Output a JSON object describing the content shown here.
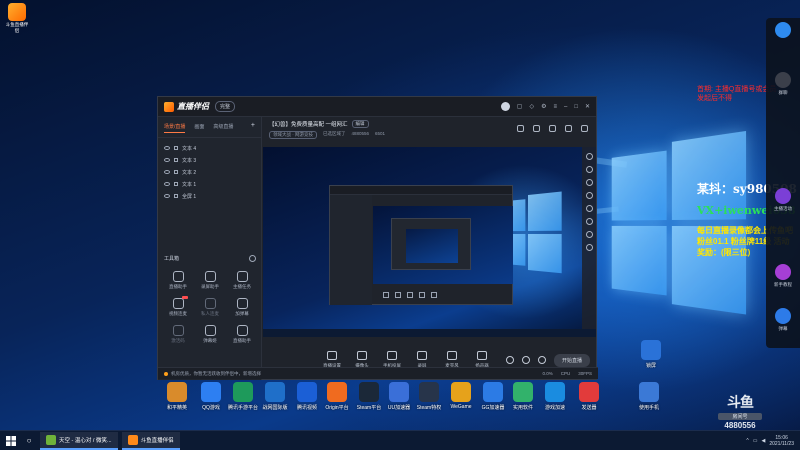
{
  "desktop": {
    "top_left_app": "斗鱼直播伴侣",
    "icons_row": [
      {
        "label": "和平精英",
        "color": "#d98b2b"
      },
      {
        "label": "QQ游戏",
        "color": "#2d7ff2"
      },
      {
        "label": "腾讯手游平台",
        "color": "#1e9a5b"
      },
      {
        "label": "战网国际版",
        "color": "#1f6fc9"
      },
      {
        "label": "腾讯视频",
        "color": "#1b5fd6"
      },
      {
        "label": "Origin平台",
        "color": "#f06b1f"
      },
      {
        "label": "Steam平台",
        "color": "#1b2838"
      },
      {
        "label": "UU加速器",
        "color": "#3a6fd8"
      },
      {
        "label": "Steam特权",
        "color": "#27344a"
      },
      {
        "label": "WeGame",
        "color": "#e6a21b"
      },
      {
        "label": "GG加速器",
        "color": "#2c7be5"
      },
      {
        "label": "实用软件",
        "color": "#32b26b"
      },
      {
        "label": "游戏加速",
        "color": "#1a8ce0"
      },
      {
        "label": "发送器",
        "color": "#e23b3b"
      },
      {
        "label": "使用手机",
        "color": "#3b79d6"
      }
    ],
    "lock_icon_label": "锁屏"
  },
  "taskbar": {
    "items": [
      {
        "label": "天空 - 温心对 / 微笑... ",
        "color": "#6fb23a"
      },
      {
        "label": "斗鱼直播伴侣",
        "color": "#ff8a1a"
      }
    ],
    "time": "15:06",
    "date": "2021/11/23"
  },
  "app": {
    "title": "直播伴侣",
    "version_badge": "完整",
    "left_tabs": [
      "场景/直播",
      "画面",
      "高级直播"
    ],
    "sources": [
      "文本 4",
      "文本 3",
      "文本 2",
      "文本 1",
      "全屏 1"
    ],
    "toolbox_title": "工具箱",
    "tools": [
      {
        "label": "直播助手",
        "dim": false,
        "new": false
      },
      {
        "label": "录屏助手",
        "dim": false,
        "new": false
      },
      {
        "label": "主播任务",
        "dim": false,
        "new": false
      },
      {
        "label": "视频连麦",
        "dim": false,
        "new": true
      },
      {
        "label": "私人连麦",
        "dim": true,
        "new": false
      },
      {
        "label": "加弹幕",
        "dim": false,
        "new": false
      },
      {
        "label": "激活码",
        "dim": true,
        "new": false
      },
      {
        "label": "弹幕姬",
        "dim": false,
        "new": false
      },
      {
        "label": "直播助手",
        "dim": false,
        "new": false
      }
    ],
    "room_title": "【幻兽】免费质量高配 一组网汇",
    "room_edit": "编辑",
    "room_category": "领域大战 · 网游竞技",
    "room_meta_1": "已选区域了",
    "room_meta_2": "4880556",
    "room_meta_3": "6501",
    "controls": [
      "直播设置",
      "摄像头",
      "手机投屏",
      "录屏",
      "麦克风",
      "扬声器"
    ],
    "go_live": "开始直播",
    "status_text": "机房优质，你暂无活跃收到伴侣中，新增选择",
    "status_right": [
      "0.0%",
      "CPU",
      "30FPS"
    ]
  },
  "overlay": {
    "red_note_1": "首期: 主播Q直播号或会员",
    "red_note_2": "发起后不得",
    "wx_white": "某抖：sy980508",
    "wx_green": "VX+iwenwei038",
    "yellow_1": "每日直播录像都会上传鱼吧",
    "yellow_2": "粉丝01.1 粉丝牌11级  活动",
    "yellow_3": "奖励：(限三位)"
  },
  "rail": [
    {
      "label": "",
      "color": "#2e8bf0"
    },
    {
      "label": "群聊",
      "color": "#3b3f4a"
    },
    {
      "label": "主播活动",
      "color": "#7b3fd6"
    },
    {
      "label": "新手教程",
      "color": "#a63fd6"
    },
    {
      "label": "弹幕",
      "color": "#2d7be8"
    }
  ],
  "watermark": {
    "logo": "斗鱼",
    "room_label": "房间号",
    "room_number": "4880556"
  }
}
